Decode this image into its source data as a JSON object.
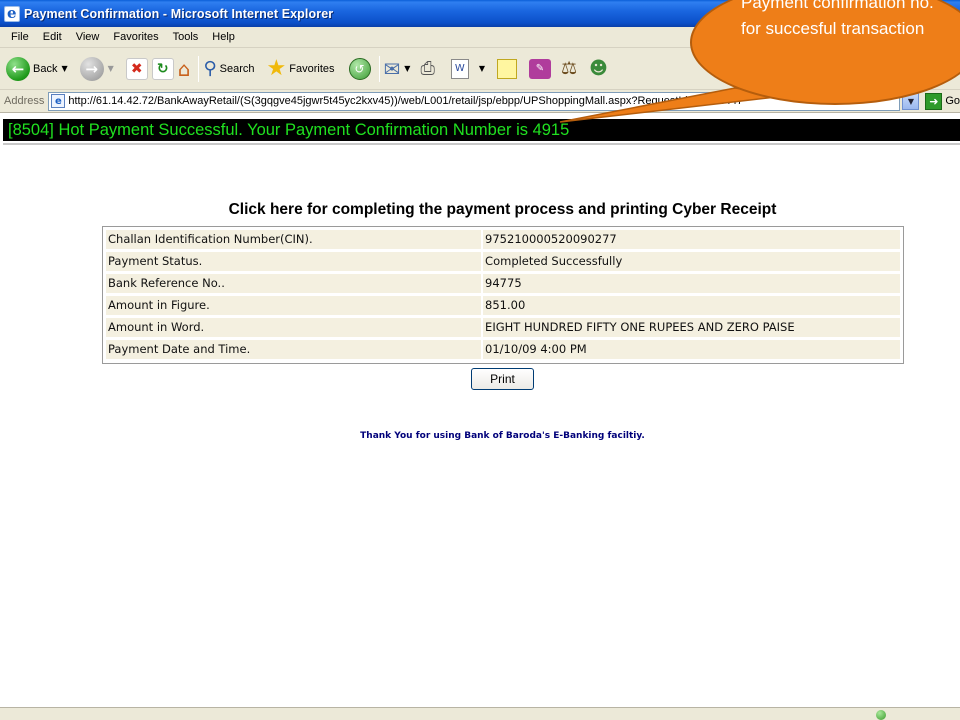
{
  "window": {
    "title": "Payment Confirmation - Microsoft Internet Explorer"
  },
  "menu": {
    "items": [
      "File",
      "Edit",
      "View",
      "Favorites",
      "Tools",
      "Help"
    ]
  },
  "toolbar": {
    "back_label": "Back",
    "search_label": "Search",
    "favorites_label": "Favorites",
    "edit_icon_label": "W"
  },
  "address": {
    "label": "Address",
    "url": "http://61.14.42.72/BankAwayRetail/(S(3gqgve45jgwr5t45yc2kxv45))/web/L001/retail/jsp/ebpp/UPShoppingMall.aspx?RequestId=36904447",
    "go_label": "Go"
  },
  "page": {
    "status_message": "[8504]  Hot Payment Successful. Your Payment Confirmation Number is 4915",
    "receipt_link": "Click here for completing the payment process and printing Cyber Receipt",
    "rows": [
      {
        "label": "Challan Identification Number(CIN).",
        "value": "975210000520090277"
      },
      {
        "label": "Payment Status.",
        "value": "Completed Successfully"
      },
      {
        "label": "Bank Reference No..",
        "value": "94775"
      },
      {
        "label": "Amount in Figure.",
        "value": "851.00"
      },
      {
        "label": "Amount in Word.",
        "value": "EIGHT HUNDRED FIFTY ONE RUPEES AND ZERO PAISE"
      },
      {
        "label": "Payment Date and Time.",
        "value": "01/10/09 4:00 PM"
      }
    ],
    "print_label": "Print",
    "thanks": "Thank You for using Bank of Baroda's E-Banking faciltiy."
  },
  "callout": {
    "text": "Payment confirmation no. for succesful transaction",
    "color": "#ee7e18"
  },
  "colors": {
    "banner_bg": "#000000",
    "banner_text": "#20e020",
    "thanks_text": "#00007a"
  }
}
